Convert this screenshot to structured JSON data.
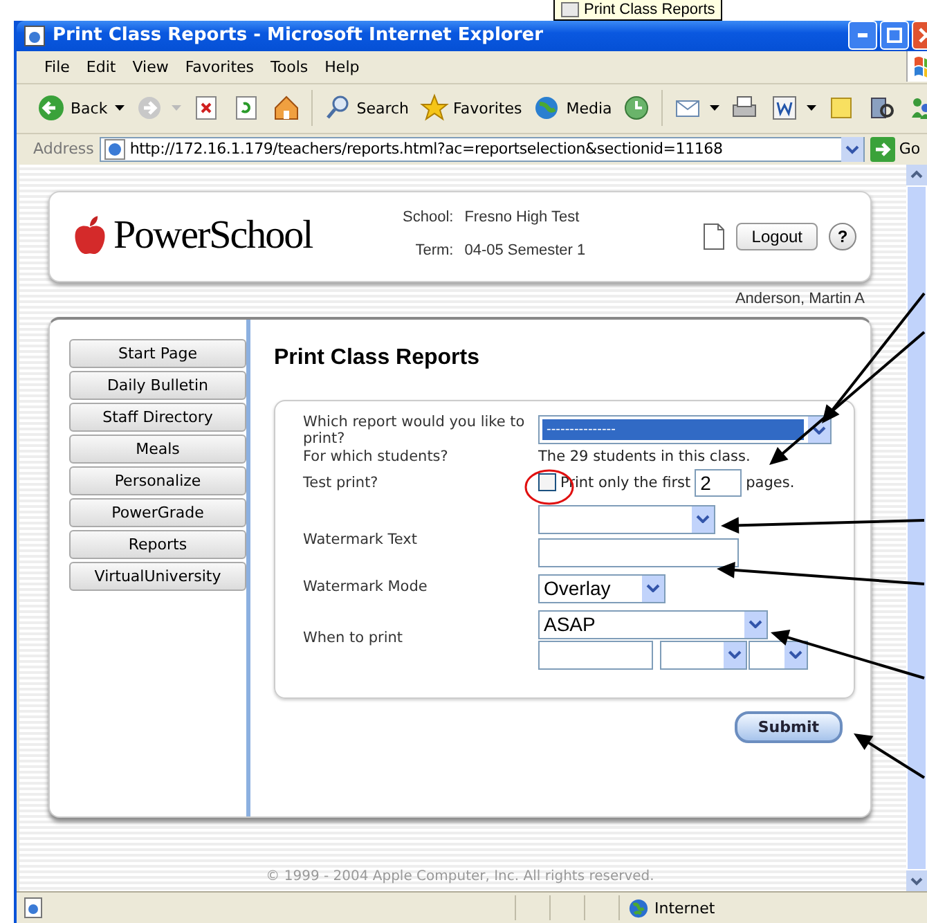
{
  "tooltip": {
    "text": "Print Class Reports"
  },
  "window": {
    "title": "Print Class Reports - Microsoft Internet Explorer"
  },
  "menu": [
    "File",
    "Edit",
    "View",
    "Favorites",
    "Tools",
    "Help"
  ],
  "toolbar": [
    {
      "kind": "back",
      "label": "Back"
    },
    {
      "kind": "forward"
    },
    {
      "kind": "stop"
    },
    {
      "kind": "refresh"
    },
    {
      "kind": "home"
    },
    {
      "kind": "search",
      "label": "Search"
    },
    {
      "kind": "favorites",
      "label": "Favorites"
    },
    {
      "kind": "media",
      "label": "Media"
    },
    {
      "kind": "history"
    },
    {
      "kind": "mail"
    },
    {
      "kind": "print"
    },
    {
      "kind": "edit"
    },
    {
      "kind": "note"
    },
    {
      "kind": "research"
    },
    {
      "kind": "messenger"
    }
  ],
  "address": {
    "label": "Address",
    "url": "http://172.16.1.179/teachers/reports.html?ac=reportselection&sectionid=11168",
    "go": "Go"
  },
  "header": {
    "logo": "PowerSchool",
    "school_label": "School:",
    "school": "Fresno High Test",
    "term_label": "Term:",
    "term": "04-05 Semester 1",
    "logout": "Logout",
    "help": "?"
  },
  "user": "Anderson, Martin A",
  "nav": [
    "Start Page",
    "Daily Bulletin",
    "Staff Directory",
    "Meals",
    "Personalize",
    "PowerGrade",
    "Reports",
    "VirtualUniversity"
  ],
  "page_title": "Print Class Reports",
  "form": {
    "report_label": "Which report would you like to print?",
    "report_value": "---------------",
    "students_label": "For which students?",
    "students_value": "The 29 students in this class.",
    "test_label": "Test print?",
    "test_checked": false,
    "test_before": "Print only the first",
    "pages": "2",
    "test_after": "pages.",
    "watermark_label": "Watermark Text",
    "mode_label": "Watermark Mode",
    "mode_value": "Overlay",
    "when_label": "When to print",
    "when_value": "ASAP"
  },
  "submit": "Submit",
  "copyright": "© 1999 - 2004 Apple Computer, Inc. All rights reserved.",
  "status": {
    "zone": "Internet"
  }
}
